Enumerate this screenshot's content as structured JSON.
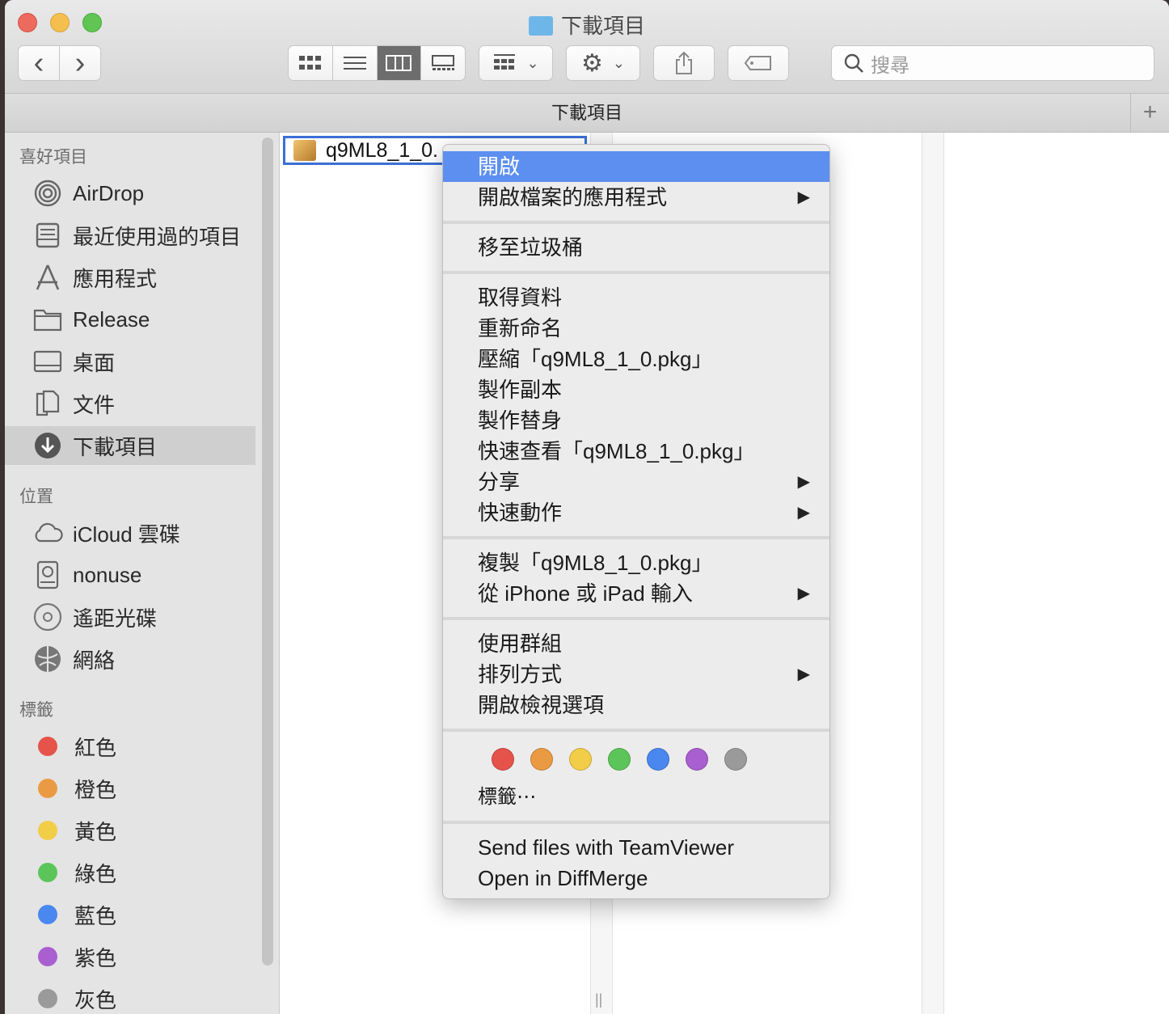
{
  "window": {
    "title": "下載項目"
  },
  "toolbar": {
    "back_glyph": "‹",
    "forward_glyph": "›",
    "search_placeholder": "搜尋"
  },
  "pathbar": {
    "title": "下載項目",
    "plus": "+"
  },
  "sidebar": {
    "favorites_heading": "喜好項目",
    "favorites": [
      {
        "label": "AirDrop",
        "icon": "airdrop-icon"
      },
      {
        "label": "最近使用過的項目",
        "icon": "recents-icon"
      },
      {
        "label": "應用程式",
        "icon": "applications-icon"
      },
      {
        "label": "Release",
        "icon": "folder-icon"
      },
      {
        "label": "桌面",
        "icon": "desktop-icon"
      },
      {
        "label": "文件",
        "icon": "documents-icon"
      },
      {
        "label": "下載項目",
        "icon": "downloads-icon"
      }
    ],
    "locations_heading": "位置",
    "locations": [
      {
        "label": "iCloud 雲碟",
        "icon": "cloud-icon"
      },
      {
        "label": "nonuse",
        "icon": "disk-icon"
      },
      {
        "label": "遙距光碟",
        "icon": "disc-icon"
      },
      {
        "label": "網絡",
        "icon": "network-icon"
      }
    ],
    "tags_heading": "標籤",
    "tags": [
      {
        "label": "紅色",
        "color": "#e5534b"
      },
      {
        "label": "橙色",
        "color": "#eb9a44"
      },
      {
        "label": "黃色",
        "color": "#f2cd48"
      },
      {
        "label": "綠色",
        "color": "#5cc55a"
      },
      {
        "label": "藍色",
        "color": "#4a87ee"
      },
      {
        "label": "紫色",
        "color": "#a95fcf"
      },
      {
        "label": "灰色",
        "color": "#9a9a9a"
      }
    ]
  },
  "content": {
    "file_name": "q9ML8_1_0."
  },
  "context_menu": {
    "items": [
      {
        "label": "開啟",
        "submenu": false,
        "highlighted": true
      },
      {
        "label": "開啟檔案的應用程式",
        "submenu": true
      },
      {
        "label": "移至垃圾桶",
        "submenu": false
      },
      {
        "label": "取得資料",
        "submenu": false
      },
      {
        "label": "重新命名",
        "submenu": false
      },
      {
        "label": "壓縮「q9ML8_1_0.pkg」",
        "submenu": false
      },
      {
        "label": "製作副本",
        "submenu": false
      },
      {
        "label": "製作替身",
        "submenu": false
      },
      {
        "label": "快速查看「q9ML8_1_0.pkg」",
        "submenu": false
      },
      {
        "label": "分享",
        "submenu": true
      },
      {
        "label": "快速動作",
        "submenu": true
      },
      {
        "label": "複製「q9ML8_1_0.pkg」",
        "submenu": false
      },
      {
        "label": "從 iPhone 或 iPad 輸入",
        "submenu": true
      },
      {
        "label": "使用群組",
        "submenu": false
      },
      {
        "label": "排列方式",
        "submenu": true
      },
      {
        "label": "開啟檢視選項",
        "submenu": false
      },
      {
        "label": "標籤⋯",
        "submenu": false
      },
      {
        "label": "Send files with TeamViewer",
        "submenu": false
      },
      {
        "label": "Open in DiffMerge",
        "submenu": false
      }
    ],
    "arrow_glyph": "▶",
    "tag_colors": [
      "#e5534b",
      "#eb9a44",
      "#f2cd48",
      "#5cc55a",
      "#4a87ee",
      "#a95fcf",
      "#9a9a9a"
    ]
  },
  "grip": "||"
}
